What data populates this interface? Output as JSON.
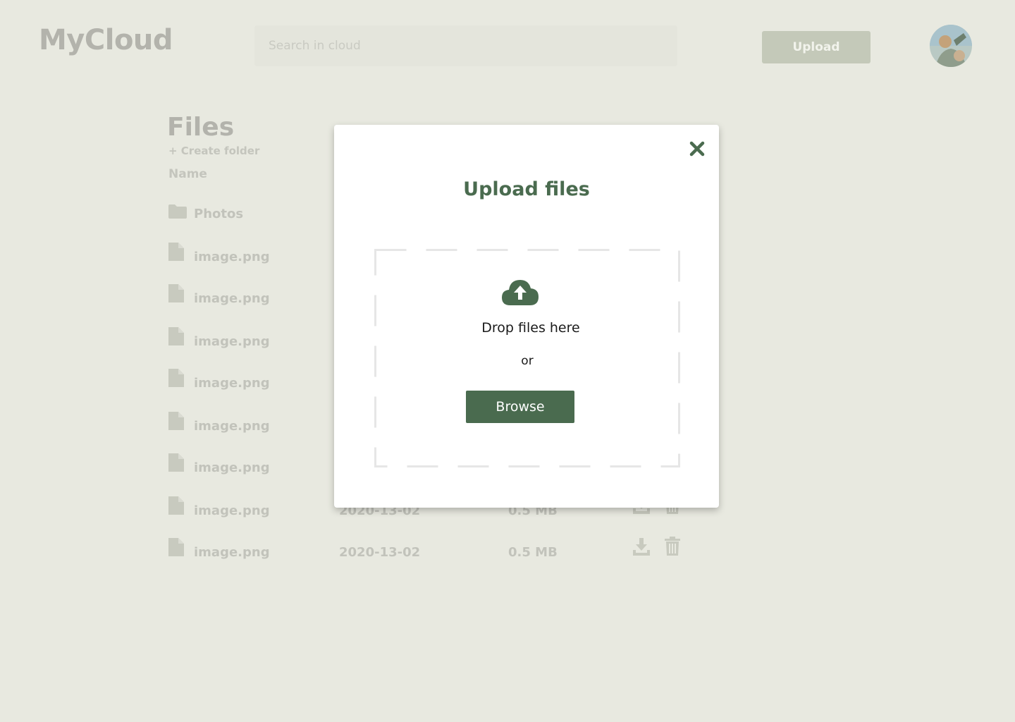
{
  "header": {
    "logo": "MyCloud",
    "search_placeholder": "Search in cloud",
    "upload_label": "Upload"
  },
  "files": {
    "title": "Files",
    "create_folder": "+ Create folder",
    "column_name": "Name",
    "rows": [
      {
        "type": "folder",
        "name": "Photos"
      },
      {
        "type": "file",
        "name": "image.png"
      },
      {
        "type": "file",
        "name": "image.png"
      },
      {
        "type": "file",
        "name": "image.png"
      },
      {
        "type": "file",
        "name": "image.png"
      },
      {
        "type": "file",
        "name": "image.png"
      },
      {
        "type": "file",
        "name": "image.png"
      },
      {
        "type": "file",
        "name": "image.png",
        "date": "2020-13-02",
        "size": "0.5 MB"
      },
      {
        "type": "file",
        "name": "image.png",
        "date": "2020-13-02",
        "size": "0.5 MB"
      }
    ]
  },
  "modal": {
    "title": "Upload files",
    "drop_text": "Drop files here",
    "or_text": "or",
    "browse_label": "Browse"
  },
  "colors": {
    "accent": "#4a6b4f",
    "background": "#e8e9e0",
    "muted_text": "#c2c3bb"
  },
  "icons": {
    "close": "close-icon",
    "upload_cloud": "cloud-upload-icon",
    "folder": "folder-icon",
    "file": "file-icon",
    "download": "download-icon",
    "delete": "trash-icon"
  }
}
